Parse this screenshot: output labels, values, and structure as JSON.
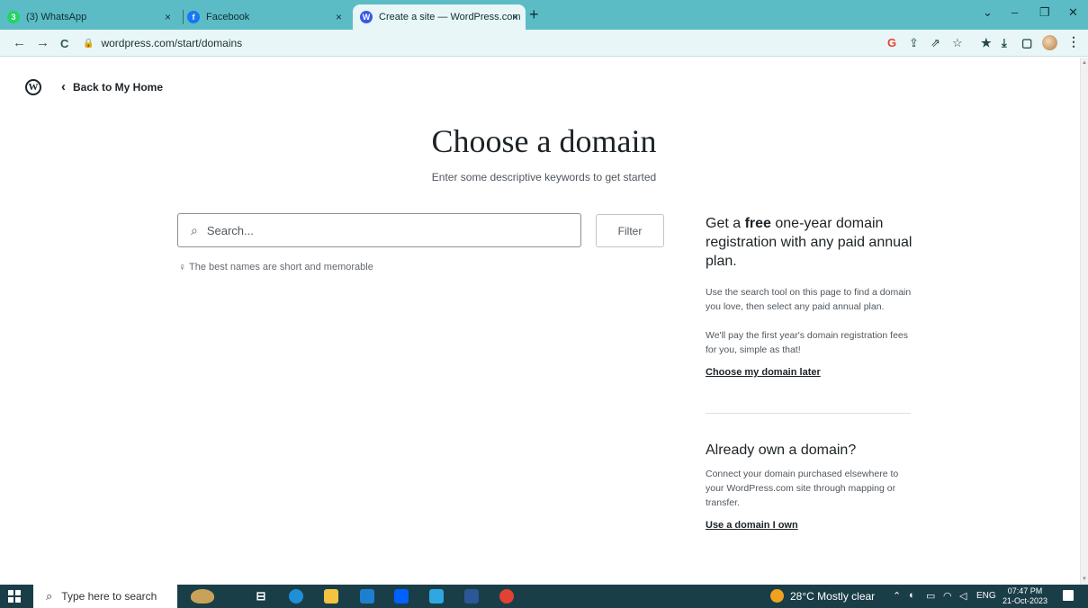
{
  "browser": {
    "tabs": [
      {
        "title": "(3) WhatsApp",
        "favicon": "whatsapp-icon",
        "color": "#25d366",
        "glyph": "3",
        "active": false
      },
      {
        "title": "Facebook",
        "favicon": "facebook-icon",
        "color": "#1877f2",
        "glyph": "f",
        "active": false
      },
      {
        "title": "Create a site — WordPress.com",
        "favicon": "wordpress-icon",
        "color": "#3858e9",
        "glyph": "W",
        "active": true
      }
    ],
    "close_glyph": "×",
    "new_tab_glyph": "+",
    "url": "wordpress.com/start/domains",
    "window_controls": [
      "⌄",
      "–",
      "❐",
      "✕"
    ],
    "nav_glyphs": {
      "back": "←",
      "forward": "→",
      "reload": "C"
    },
    "toolbar_icons": [
      "G",
      "⇪",
      "⇗",
      "☆",
      "★",
      "⤓",
      "▢"
    ]
  },
  "header": {
    "back_label": "Back to My Home"
  },
  "main": {
    "title": "Choose a domain",
    "subtitle": "Enter some descriptive keywords to get started",
    "search_placeholder": "Search...",
    "filter_label": "Filter",
    "tip": "The best names are short and memorable"
  },
  "sidebar": {
    "promo_pre": "Get a ",
    "promo_bold": "free",
    "promo_post": " one-year domain registration with any paid annual plan.",
    "promo_text_1": "Use the search tool on this page to find a domain you love, then select any paid annual plan.",
    "promo_text_2": "We'll pay the first year's domain registration fees for you, simple as that!",
    "promo_link": "Choose my domain later",
    "own_heading": "Already own a domain?",
    "own_text": "Connect your domain purchased elsewhere to your WordPress.com site through mapping or transfer.",
    "own_link": "Use a domain I own"
  },
  "taskbar": {
    "search_placeholder": "Type here to search",
    "weather": "28°C  Mostly clear",
    "language": "ENG",
    "time": "07:47 PM",
    "date": "21-Oct-2023"
  },
  "colors": {
    "tab_strip": "#5cbcc6",
    "toolbar": "#e9f6f7",
    "taskbar": "#1a3e48"
  }
}
